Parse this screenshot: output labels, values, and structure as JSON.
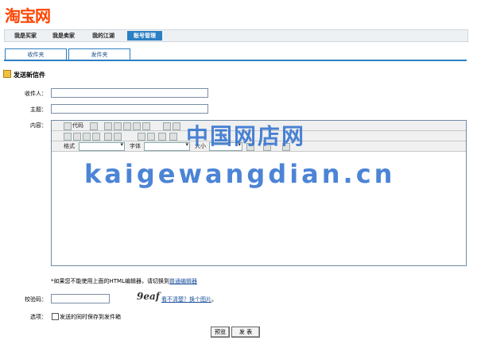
{
  "logo": "淘宝网",
  "nav": {
    "tabs": [
      "我是买家",
      "我是卖家",
      "我的江湖",
      "账号管理"
    ],
    "active": "账号管理"
  },
  "subtabs": [
    "收件夹",
    "发件夹"
  ],
  "section_title": "发送新信件",
  "form": {
    "recipient_label": "收件人：",
    "subject_label": "主题：",
    "content_label": "内容：",
    "captcha_label": "校验码：",
    "options_label": "选项："
  },
  "editor": {
    "code_label": "代码",
    "format_label": "格式",
    "font_label": "字体",
    "size_label": "大小"
  },
  "watermark": {
    "line1": "中国网店网",
    "line2": "kaigewangdian.cn"
  },
  "note": {
    "text": "*如果您不能使用上面的HTML编辑器，请切换到",
    "link": "普通编辑器"
  },
  "captcha": {
    "image_text": "9eaf",
    "refresh_link": "看不清楚？换个图片",
    "refresh_suffix": "。"
  },
  "save_option": "发送的同时保存到发件箱",
  "buttons": {
    "preview": "预览",
    "send": "发 表"
  },
  "colors": {
    "brand": "#ff4400",
    "accent": "#2b7fc3",
    "watermark": "#2d6fd0"
  }
}
